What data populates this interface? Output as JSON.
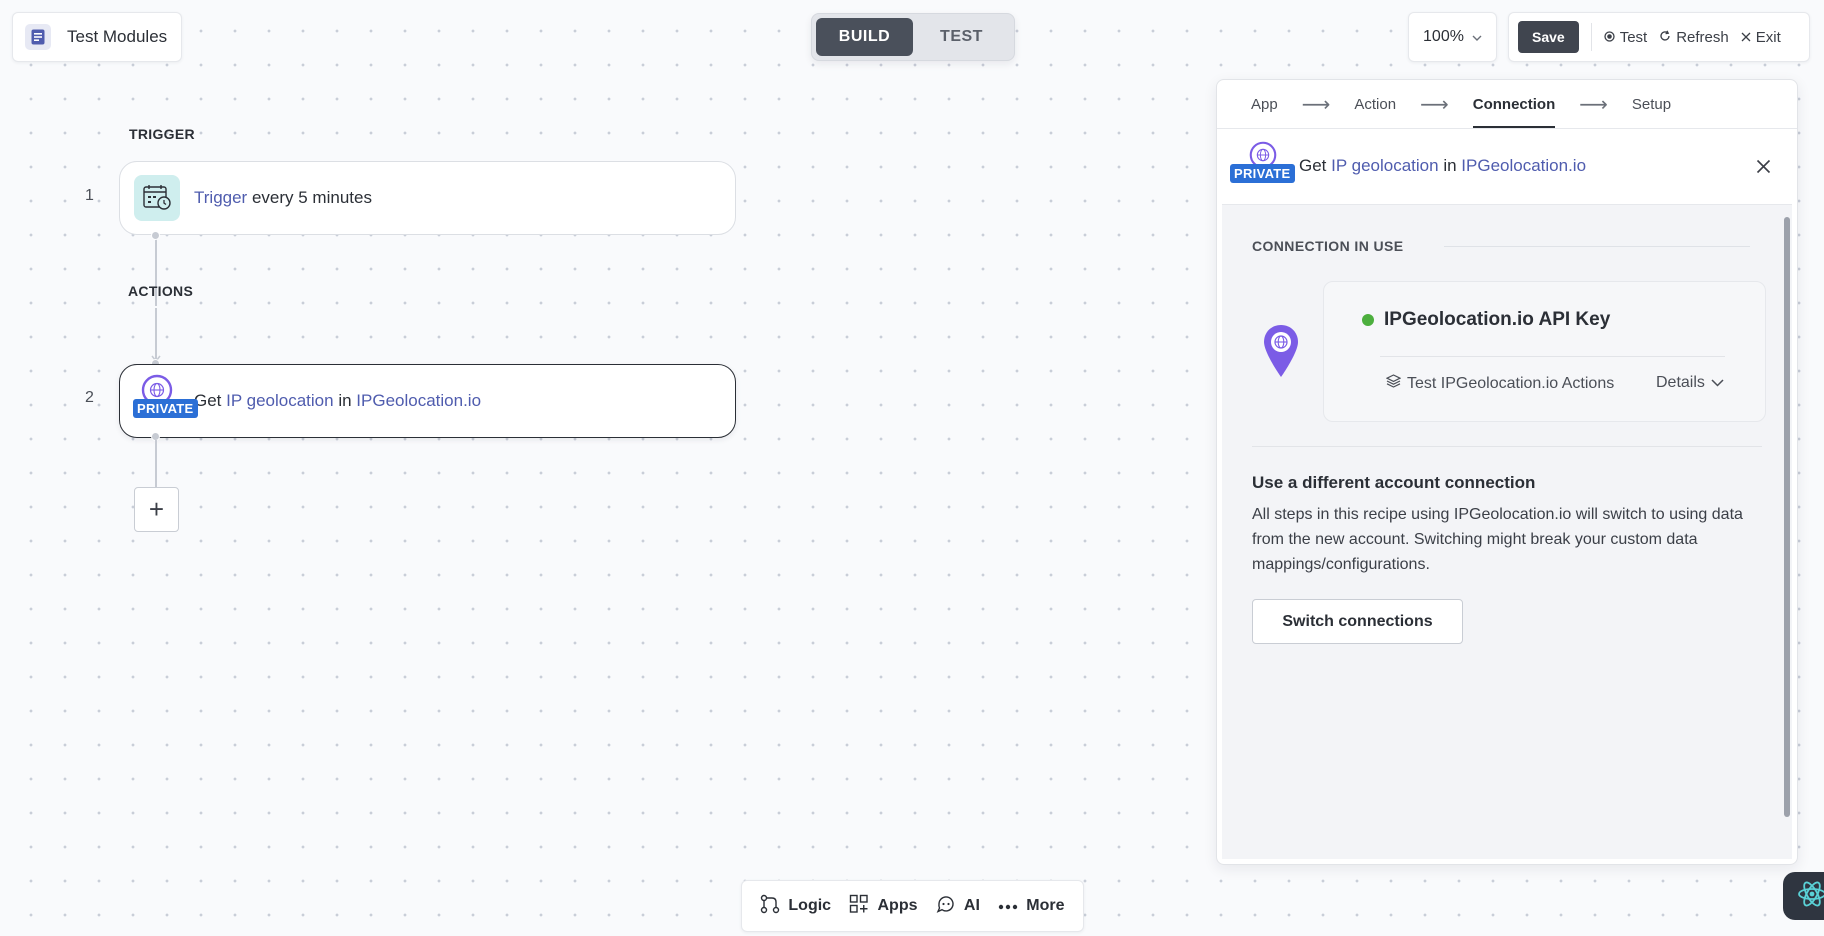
{
  "app": {
    "title": "Test Modules"
  },
  "mode": {
    "build": "BUILD",
    "test": "TEST",
    "active": "build"
  },
  "zoom": {
    "level": "100%"
  },
  "toolbar": {
    "save": "Save",
    "test": "Test",
    "refresh": "Refresh",
    "exit": "Exit"
  },
  "flow": {
    "trigger_label": "TRIGGER",
    "actions_label": "ACTIONS",
    "step1": {
      "number": "1",
      "link": "Trigger",
      "text": "every 5 minutes"
    },
    "step2": {
      "number": "2",
      "prefix": "Get",
      "action": "IP geolocation",
      "mid": "in",
      "app": "IPGeolocation.io",
      "badge": "PRIVATE"
    },
    "add_label": "+"
  },
  "panel": {
    "tabs": [
      {
        "label": "App"
      },
      {
        "label": "Action"
      },
      {
        "label": "Connection"
      },
      {
        "label": "Setup"
      }
    ],
    "active_tab": "Connection",
    "header": {
      "prefix": "Get",
      "action": "IP geolocation",
      "mid": "in",
      "app": "IPGeolocation.io",
      "badge": "PRIVATE"
    },
    "connection_in_use": "CONNECTION IN USE",
    "connection": {
      "name": "IPGeolocation.io API Key",
      "status_color": "#4caf3e",
      "test_label": "Test IPGeolocation.io Actions",
      "details_label": "Details"
    },
    "different": {
      "title": "Use a different account connection",
      "text": "All steps in this recipe using IPGeolocation.io will switch to using data from the new account. Switching might break your custom data mappings/configurations.",
      "button": "Switch connections"
    }
  },
  "bottom_bar": {
    "logic": "Logic",
    "apps": "Apps",
    "ai": "AI",
    "more": "More"
  },
  "colors": {
    "accent": "#4f5cae",
    "private_badge": "#2b6fd6",
    "dark": "#40454f"
  }
}
